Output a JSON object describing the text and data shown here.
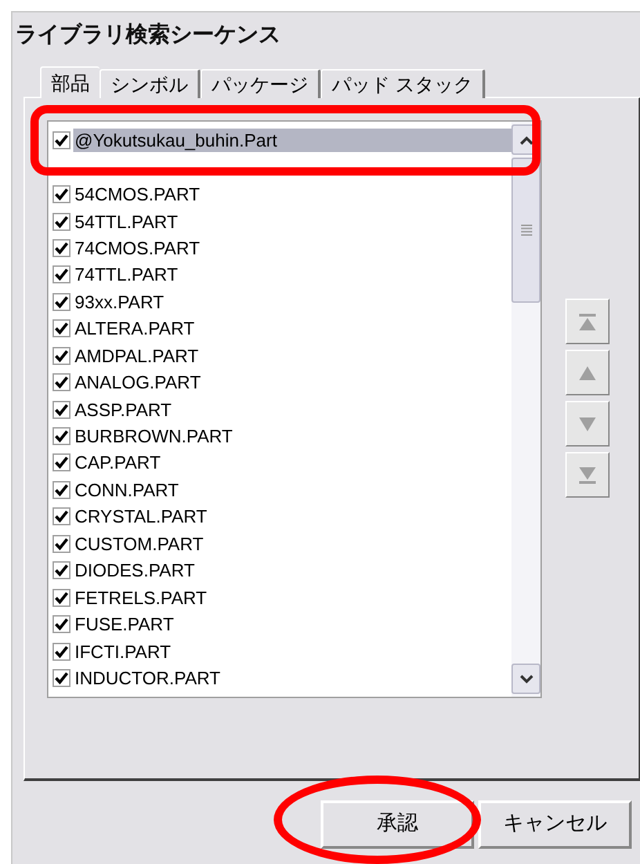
{
  "window": {
    "title": "ライブラリ検索シーケンス"
  },
  "tabs": [
    {
      "label": "部品",
      "selected": true
    },
    {
      "label": "シンボル",
      "selected": false
    },
    {
      "label": "パッケージ",
      "selected": false
    },
    {
      "label": "パッド スタック",
      "selected": false
    }
  ],
  "list": {
    "items": [
      {
        "label": "@Yokutsukau_buhin.Part",
        "checked": true,
        "selected": true
      },
      {
        "label": "54CMOS.PART",
        "checked": true,
        "selected": false
      },
      {
        "label": "54TTL.PART",
        "checked": true,
        "selected": false
      },
      {
        "label": "74CMOS.PART",
        "checked": true,
        "selected": false
      },
      {
        "label": "74TTL.PART",
        "checked": true,
        "selected": false
      },
      {
        "label": "93xx.PART",
        "checked": true,
        "selected": false
      },
      {
        "label": "ALTERA.PART",
        "checked": true,
        "selected": false
      },
      {
        "label": "AMDPAL.PART",
        "checked": true,
        "selected": false
      },
      {
        "label": "ANALOG.PART",
        "checked": true,
        "selected": false
      },
      {
        "label": "ASSP.PART",
        "checked": true,
        "selected": false
      },
      {
        "label": "BURBROWN.PART",
        "checked": true,
        "selected": false
      },
      {
        "label": "CAP.PART",
        "checked": true,
        "selected": false
      },
      {
        "label": "CONN.PART",
        "checked": true,
        "selected": false
      },
      {
        "label": "CRYSTAL.PART",
        "checked": true,
        "selected": false
      },
      {
        "label": "CUSTOM.PART",
        "checked": true,
        "selected": false
      },
      {
        "label": "DIODES.PART",
        "checked": true,
        "selected": false
      },
      {
        "label": "FETRELS.PART",
        "checked": true,
        "selected": false
      },
      {
        "label": "FUSE.PART",
        "checked": true,
        "selected": false
      },
      {
        "label": "IFCTI.PART",
        "checked": true,
        "selected": false
      },
      {
        "label": "INDUCTOR.PART",
        "checked": true,
        "selected": false
      }
    ]
  },
  "move_buttons": [
    {
      "kind": "top"
    },
    {
      "kind": "up"
    },
    {
      "kind": "down"
    },
    {
      "kind": "bottom"
    }
  ],
  "buttons": [
    {
      "label": "承認"
    },
    {
      "label": "キャンセル"
    }
  ]
}
